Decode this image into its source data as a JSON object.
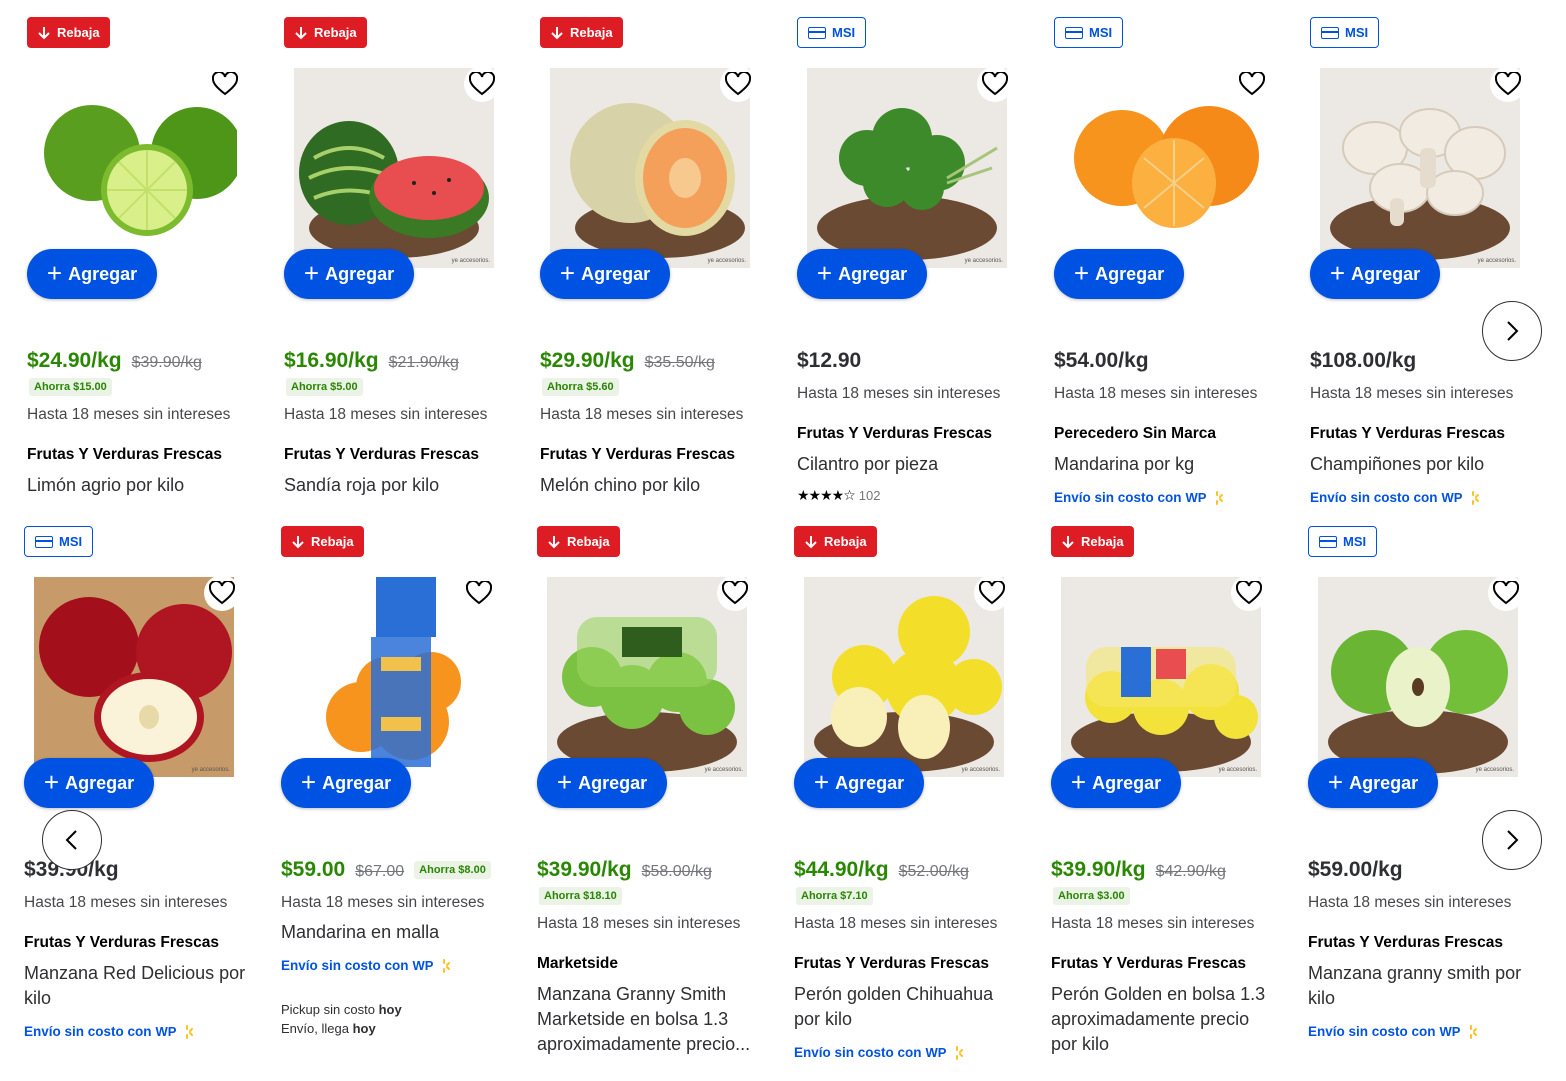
{
  "common": {
    "add_label": "Agregar",
    "msi_text": "Hasta 18 meses sin intereses",
    "ship_text": "Envío sin costo con",
    "wp_text": "WP",
    "img_note": "ye accesorios."
  },
  "row1": [
    {
      "badge": "Rebaja",
      "price": "$24.90/kg",
      "was": "$39.90/kg",
      "savings": "Ahorra $15.00",
      "brand": "Frutas Y Verduras Frescas",
      "name": "Limón agrio por kilo"
    },
    {
      "badge": "Rebaja",
      "price": "$16.90/kg",
      "was": "$21.90/kg",
      "savings": "Ahorra $5.00",
      "brand": "Frutas Y Verduras Frescas",
      "name": "Sandía roja por kilo"
    },
    {
      "badge": "Rebaja",
      "price": "$29.90/kg",
      "was": "$35.50/kg",
      "savings": "Ahorra $5.60",
      "brand": "Frutas Y Verduras Frescas",
      "name": "Melón chino por kilo"
    },
    {
      "badge": "MSI",
      "price": "$12.90",
      "brand": "Frutas Y Verduras Frescas",
      "name": "Cilantro por pieza",
      "rating": 4,
      "reviews": "102"
    },
    {
      "badge": "MSI",
      "price": "$54.00/kg",
      "brand": "Perecedero Sin Marca",
      "name": "Mandarina por kg"
    },
    {
      "badge": "MSI",
      "price": "$108.00/kg",
      "brand": "Frutas Y Verduras Frescas",
      "name": "Champiñones por kilo"
    }
  ],
  "row2": [
    {
      "badge": "MSI",
      "price": "$39.90/kg",
      "brand": "Frutas Y Verduras Frescas",
      "name": "Manzana Red Delicious por kilo"
    },
    {
      "badge": "Rebaja",
      "price": "$59.00",
      "was": "$67.00",
      "savings": "Ahorra $8.00",
      "name": "Mandarina en malla",
      "pickup_label": "Pickup sin costo",
      "pickup_when": "hoy",
      "delivery_label": "Envío, llega",
      "delivery_when": "hoy"
    },
    {
      "badge": "Rebaja",
      "price": "$39.90/kg",
      "was": "$58.00/kg",
      "savings": "Ahorra $18.10",
      "brand": "Marketside",
      "name": "Manzana Granny Smith Marketside en bolsa 1.3 aproximadamente precio..."
    },
    {
      "badge": "Rebaja",
      "price": "$44.90/kg",
      "was": "$52.00/kg",
      "savings": "Ahorra $7.10",
      "brand": "Frutas Y Verduras Frescas",
      "name": "Perón golden Chihuahua por kilo"
    },
    {
      "badge": "Rebaja",
      "price": "$39.90/kg",
      "was": "$42.90/kg",
      "savings": "Ahorra $3.00",
      "brand": "Frutas Y Verduras Frescas",
      "name": "Perón Golden en bolsa 1.3 aproximadamente precio por kilo"
    },
    {
      "badge": "MSI",
      "price": "$59.00/kg",
      "brand": "Frutas Y Verduras Frescas",
      "name": "Manzana granny smith por kilo"
    }
  ],
  "colors": {
    "primary_blue": "#0053e2",
    "rebaja_red": "#de1c24",
    "sale_green": "#2a8703",
    "spark_yellow": "#ffc220"
  }
}
